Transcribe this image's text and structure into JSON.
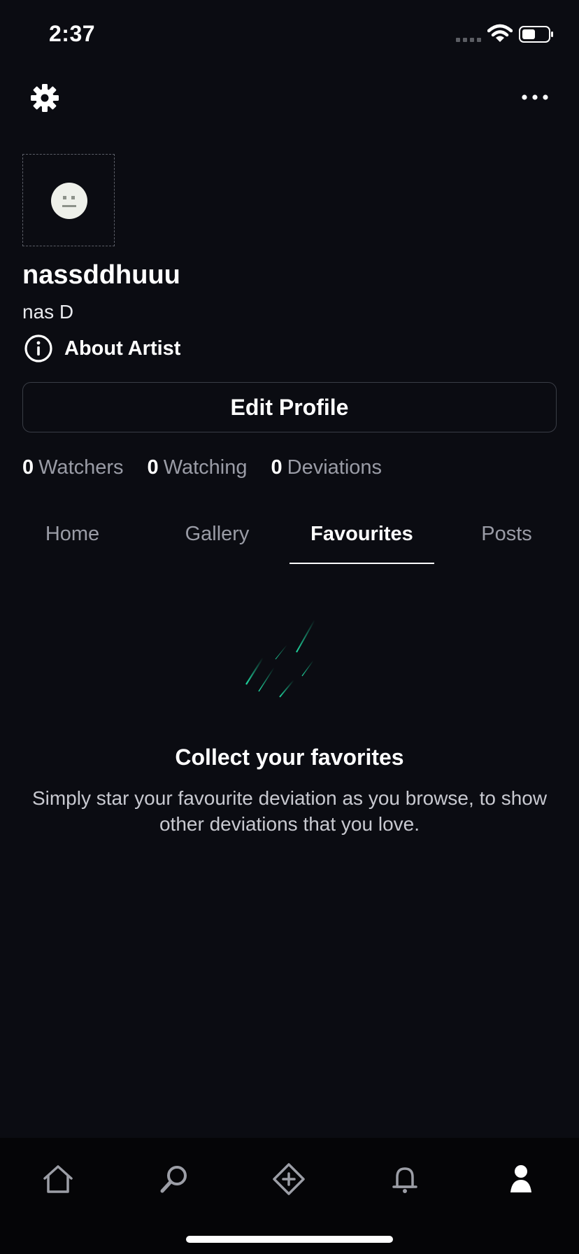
{
  "status_bar": {
    "time": "2:37"
  },
  "icons": {
    "settings": "gear-icon",
    "more": "more-horizontal-icon",
    "about": "info-icon",
    "nav_home": "home-icon",
    "nav_search": "search-icon",
    "nav_create": "plus-icon",
    "nav_notifications": "bell-icon",
    "nav_profile": "profile-icon"
  },
  "profile": {
    "username": "nassddhuuu",
    "display_name": "nas D",
    "about_label": "About Artist",
    "edit_label": "Edit Profile"
  },
  "stats": [
    {
      "value": "0",
      "label": "Watchers"
    },
    {
      "value": "0",
      "label": "Watching"
    },
    {
      "value": "0",
      "label": "Deviations"
    }
  ],
  "tabs": [
    {
      "label": "Home"
    },
    {
      "label": "Gallery"
    },
    {
      "label": "Favourites",
      "active": true
    },
    {
      "label": "Posts"
    }
  ],
  "empty_state": {
    "title": "Collect your favorites",
    "description": "Simply star your favourite deviation as you browse, to show other deviations that you love."
  },
  "colors": {
    "background": "#0b0c12",
    "accent": "#1fd8a0",
    "muted_text": "#9a9ca6",
    "nav_background": "#050507"
  }
}
